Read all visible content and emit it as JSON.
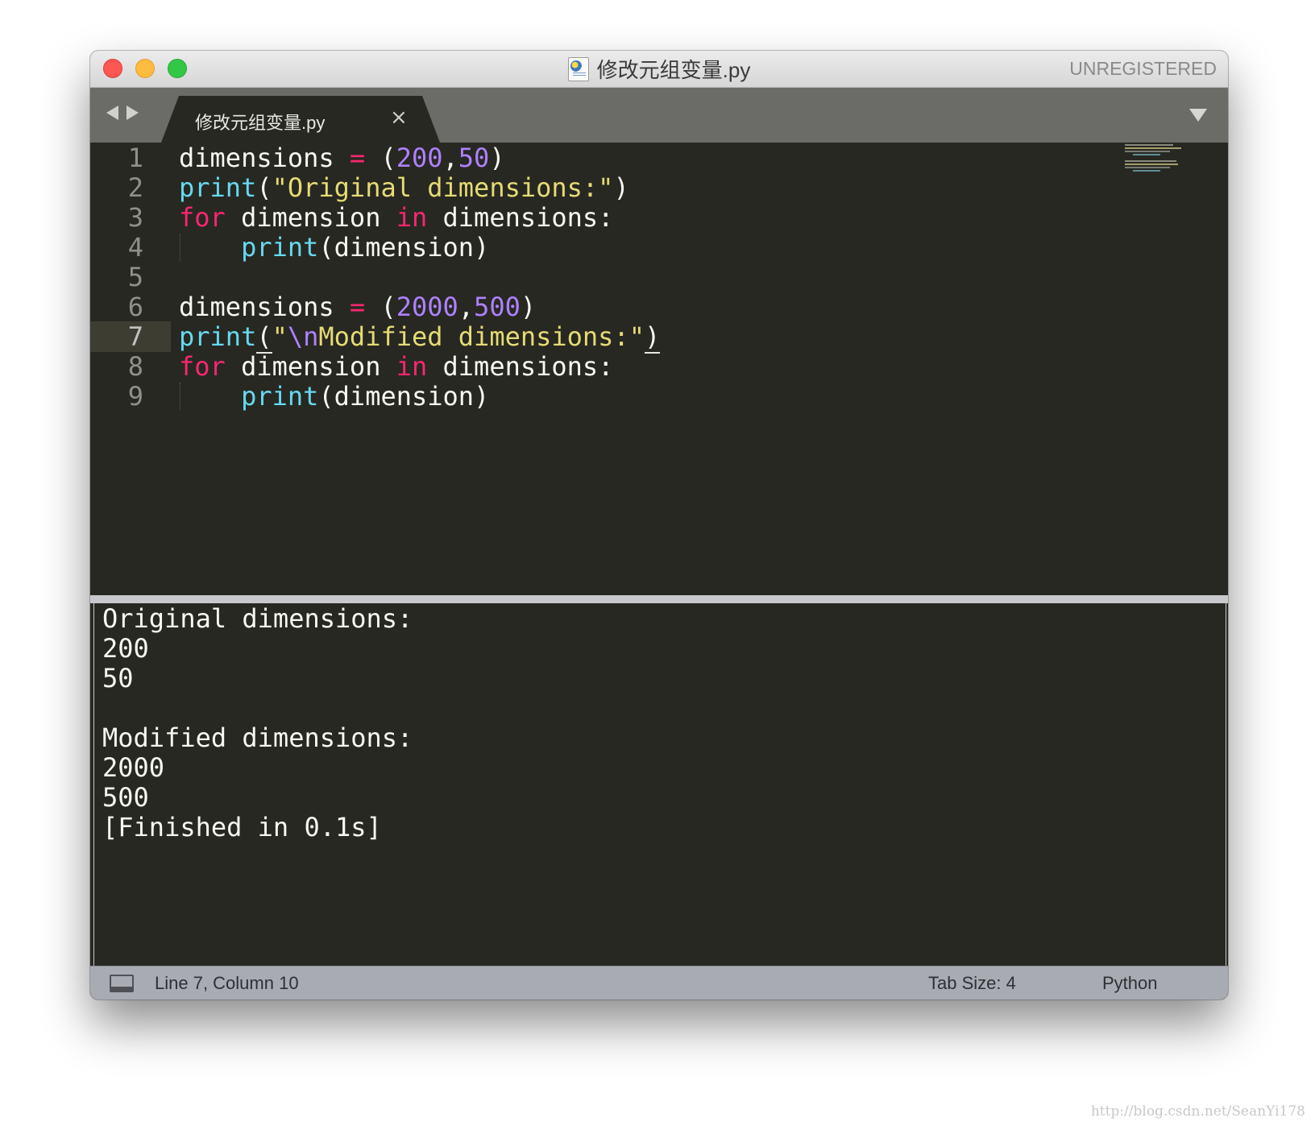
{
  "window": {
    "title": "修改元组变量.py",
    "badge": "UNREGISTERED"
  },
  "tab": {
    "label": "修改元组变量.py",
    "close_glyph": "×"
  },
  "editor": {
    "current_line": 7,
    "lines": [
      {
        "number": "1",
        "parts": [
          "dimensions ",
          "=",
          " (",
          "200",
          ",",
          "50",
          ")"
        ]
      },
      {
        "number": "2",
        "parts": [
          "print",
          "(",
          "\"Original dimensions:\"",
          ")"
        ]
      },
      {
        "number": "3",
        "parts": [
          "for",
          " dimension ",
          "in",
          " dimensions:"
        ]
      },
      {
        "number": "4",
        "parts": [
          "    ",
          "print",
          "(dimension)"
        ]
      },
      {
        "number": "5",
        "parts": []
      },
      {
        "number": "6",
        "parts": [
          "dimensions ",
          "=",
          " (",
          "2000",
          ",",
          "500",
          ")"
        ]
      },
      {
        "number": "7",
        "parts": [
          "print",
          "(",
          "\"",
          "\\n",
          "Modified dimensions:\"",
          ")"
        ]
      },
      {
        "number": "8",
        "parts": [
          "for",
          " dimension ",
          "in",
          " dimensions:"
        ]
      },
      {
        "number": "9",
        "parts": [
          "    ",
          "print",
          "(dimension)"
        ]
      }
    ]
  },
  "console": {
    "lines": [
      "Original dimensions:",
      "200",
      "50",
      "",
      "Modified dimensions:",
      "2000",
      "500",
      "[Finished in 0.1s]"
    ]
  },
  "statusbar": {
    "position": "Line 7, Column 10",
    "tab_size": "Tab Size: 4",
    "syntax": "Python"
  },
  "watermark": "http://blog.csdn.net/SeanYi178",
  "colors": {
    "background": "#272822",
    "keyword": "#f92672",
    "function": "#66d9ef",
    "number": "#ae81ff",
    "string": "#e6db74",
    "text": "#f8f8f2"
  }
}
